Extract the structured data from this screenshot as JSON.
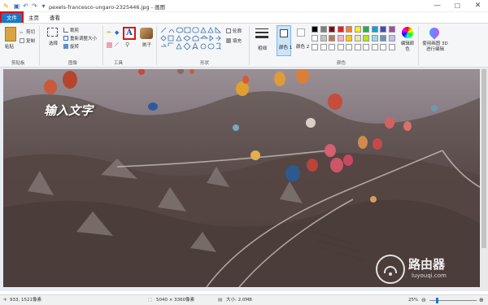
{
  "titlebar": {
    "title": "pexels-francesco-ungaro-2325446.jpg - 画图",
    "quick_access": [
      "save-icon",
      "undo-icon",
      "redo-icon",
      "customize-icon"
    ],
    "minimize": "—",
    "maximize": "☐",
    "close": "✕"
  },
  "tabs": {
    "file": "文件",
    "home": "主页",
    "view": "查看"
  },
  "ribbon": {
    "clipboard": {
      "paste": "粘贴",
      "cut": "剪切",
      "copy": "复制",
      "label": "剪贴板"
    },
    "image": {
      "select": "选择",
      "crop": "裁剪",
      "resize": "重新调整大小",
      "rotate": "旋转",
      "label": "图像"
    },
    "tools": {
      "label": "工具",
      "text_tool": "A"
    },
    "brushes": {
      "label": "刷子"
    },
    "shapes": {
      "label": "形状",
      "outline": "轮廓",
      "fill": "填充"
    },
    "thickness": {
      "label": "粗细"
    },
    "colors": {
      "color1": "颜色 1",
      "color2": "颜色 2",
      "edit": "编辑颜色",
      "label": "颜色",
      "palette_row1": [
        "#000000",
        "#7f7f7f",
        "#880015",
        "#ed1c24",
        "#ff7f27",
        "#fff200",
        "#22b14c",
        "#00a2e8",
        "#3f48cc",
        "#a349a4"
      ],
      "palette_row2": [
        "#ffffff",
        "#c3c3c3",
        "#b97a57",
        "#ffaec9",
        "#ffc90e",
        "#efe4b0",
        "#b5e61d",
        "#99d9ea",
        "#7092be",
        "#c8bfe7"
      ]
    },
    "paint3d": {
      "label": "使用画图 3D 进行编辑"
    }
  },
  "canvas": {
    "overlay_text": "输入文字"
  },
  "watermark": {
    "brand": "路由器",
    "url": "luyouqi.com"
  },
  "status": {
    "cursor": "933, 1521像素",
    "dimensions": "5040 × 3360像素",
    "size": "大小: 2.0MB",
    "zoom": "25%"
  }
}
